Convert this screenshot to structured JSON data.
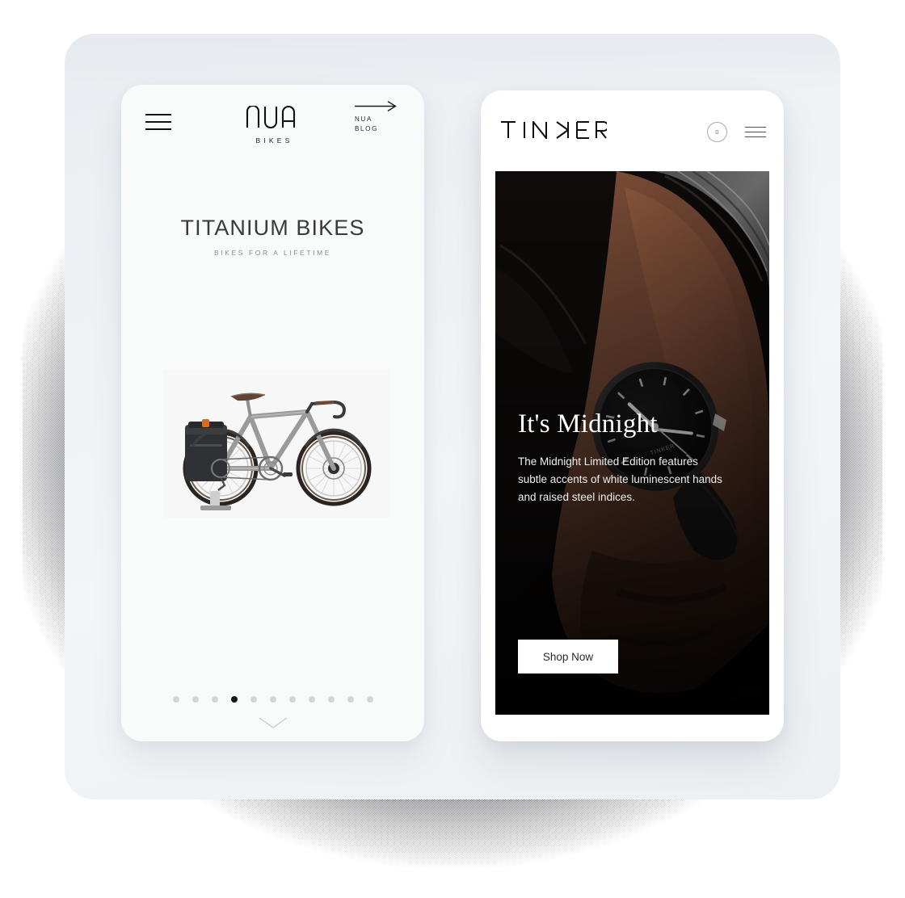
{
  "theme": {
    "page_bg": "#ffffff",
    "outer_panel_bg": "#eef1f4",
    "left_card_bg": "#f9fafa",
    "right_card_bg": "#ffffff",
    "accent_dark": "#171717",
    "hero_bg": "#0a0706",
    "dot_inactive": "#d6d6d6",
    "dot_active": "#171717"
  },
  "left_phone": {
    "name": "nua-bikes-mobile-site",
    "header": {
      "menu_icon": "hamburger-menu-icon",
      "logo_text": "NUA",
      "logo_subtext": "BIKES",
      "blog_link": {
        "icon": "arrow-right-icon",
        "line1": "NUA",
        "line2": "BLOG"
      }
    },
    "hero": {
      "title": "TITANIUM BIKES",
      "subtitle": "BIKES FOR A LIFETIME",
      "product_image": "titanium-bicycle-with-pannier-bag"
    },
    "carousel": {
      "total_dots": 11,
      "active_index": 4,
      "scroll_hint_icon": "chevron-down-icon"
    }
  },
  "right_phone": {
    "name": "tinker-watches-mobile-site",
    "header": {
      "logo_text": "TINKER",
      "cart": {
        "icon": "cart-circle-icon",
        "count": "0"
      },
      "menu_icon": "hamburger-menu-icon"
    },
    "hero": {
      "background_image": "wrist-wearing-black-minimalist-watch",
      "title": "It's Midnight",
      "description": "The Midnight Limited Edition features subtle accents of white luminescent hands and raised steel indices.",
      "cta_label": "Shop Now"
    }
  }
}
